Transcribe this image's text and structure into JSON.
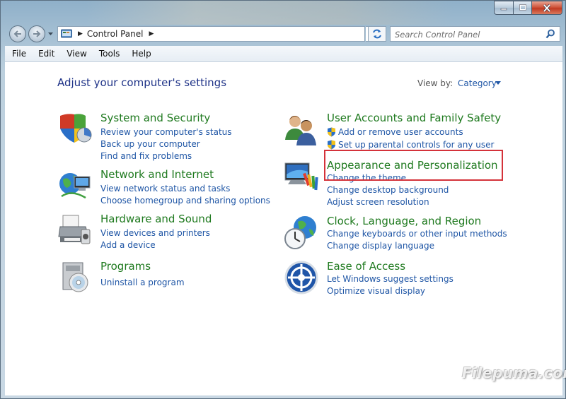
{
  "address_bar": {
    "crumb": "Control Panel"
  },
  "search": {
    "placeholder": "Search Control Panel"
  },
  "menu": [
    "File",
    "Edit",
    "View",
    "Tools",
    "Help"
  ],
  "page": {
    "heading": "Adjust your computer's settings",
    "view_by_label": "View by:",
    "view_by_value": "Category"
  },
  "categories": [
    {
      "title": "System and Security",
      "icon": "shield-icon",
      "links": [
        "Review your computer's status",
        "Back up your computer",
        "Find and fix problems"
      ]
    },
    {
      "title": "Network and Internet",
      "icon": "network-globe-icon",
      "links": [
        "View network status and tasks",
        "Choose homegroup and sharing options"
      ]
    },
    {
      "title": "Hardware and Sound",
      "icon": "printer-icon",
      "links": [
        "View devices and printers",
        "Add a device"
      ]
    },
    {
      "title": "Programs",
      "icon": "programs-disc-icon",
      "links": [
        "Uninstall a program"
      ]
    },
    {
      "title": "User Accounts and Family Safety",
      "icon": "users-icon",
      "links": [
        "Add or remove user accounts",
        "Set up parental controls for any user"
      ]
    },
    {
      "title": "Appearance and Personalization",
      "icon": "monitor-paint-icon",
      "links": [
        "Change the theme",
        "Change desktop background",
        "Adjust screen resolution"
      ]
    },
    {
      "title": "Clock, Language, and Region",
      "icon": "clock-globe-icon",
      "links": [
        "Change keyboards or other input methods",
        "Change display language"
      ]
    },
    {
      "title": "Ease of Access",
      "icon": "ease-of-access-icon",
      "links": [
        "Let Windows suggest settings",
        "Optimize visual display"
      ]
    }
  ],
  "watermark": "Filepuma.com",
  "colors": {
    "category_title": "#1f7a1f",
    "link": "#1e55a5",
    "heading": "#1e3287",
    "highlight_box": "#d4323a"
  }
}
